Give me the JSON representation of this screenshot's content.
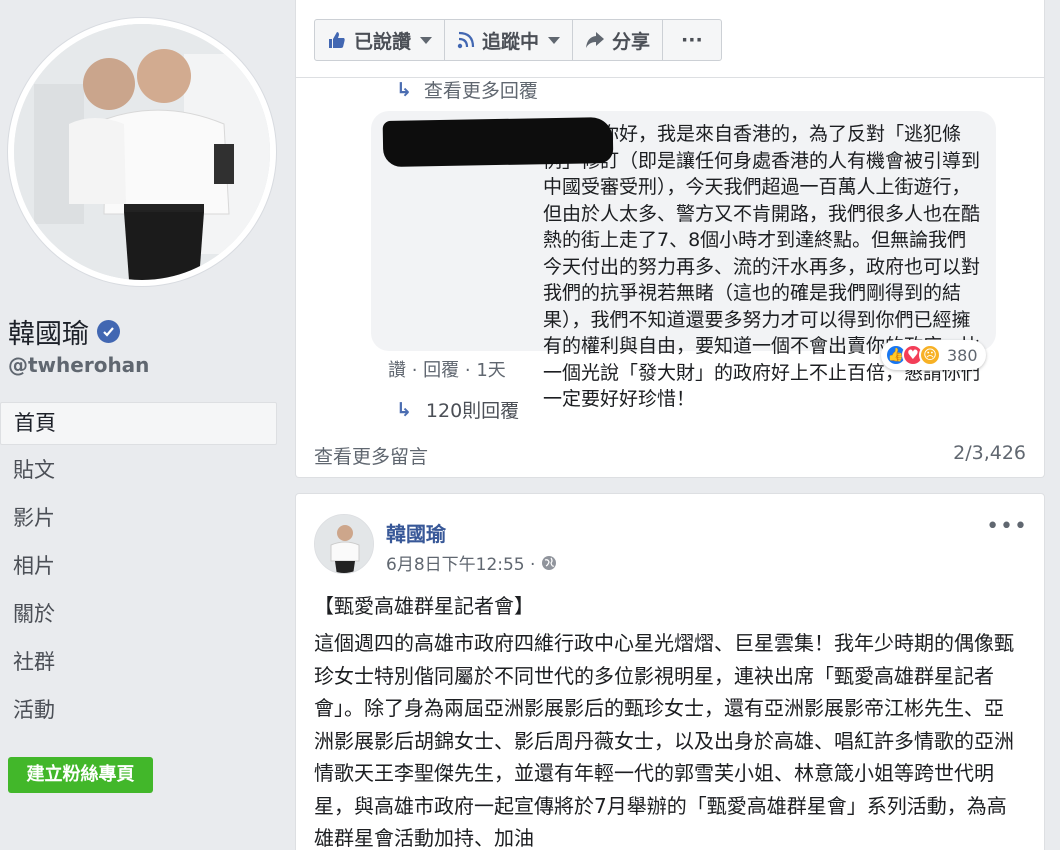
{
  "profile": {
    "name": "韓國瑜",
    "handle": "@twherohan"
  },
  "nav": {
    "items": [
      "首頁",
      "貼文",
      "影片",
      "相片",
      "關於",
      "社群",
      "活動"
    ],
    "create_button": "建立粉絲專頁"
  },
  "action_bar": {
    "liked_label": "已說讚",
    "following_label": "追蹤中",
    "share_label": "分享",
    "more_label": "···"
  },
  "comments": {
    "more_replies_top": "查看更多回覆",
    "comment_text": "台灣人你好，我是來自香港的，為了反對「逃犯條例」修訂（即是讓任何身處香港的人有機會被引導到中國受審受刑），今天我們超過一百萬人上街遊行，但由於人太多、警方又不肯開路，我們很多人也在酷熱的街上走了7、8個小時才到達終點。但無論我們今天付出的努力再多、流的汗水再多，政府也可以對我們的抗爭視若無睹（這也的確是我們剛得到的結果），我們不知道還要多努力才可以得到你們已經擁有的權利與自由，要知道一個不會出賣你的政府，比一個光說「發大財」的政府好上不止百倍，懇請你們一定要好好珍惜！",
    "reaction_count": "380",
    "actions": "讚 · 回覆 · 1天",
    "replies_link": "120則回覆",
    "view_more": "查看更多留言",
    "count": "2/3,426"
  },
  "post": {
    "author": "韓國瑜",
    "timestamp": "6月8日下午12:55 ·",
    "title": "【甄愛高雄群星記者會】",
    "body": "這個週四的高雄市政府四維行政中心星光熠熠、巨星雲集！我年少時期的偶像甄珍女士特別偕同屬於不同世代的多位影視明星，連袂出席「甄愛高雄群星記者會」。除了身為兩屆亞洲影展影后的甄珍女士，還有亞洲影展影帝江彬先生、亞洲影展影后胡錦女士、影后周丹薇女士，以及出身於高雄、唱紅許多情歌的亞洲情歌天王李聖傑先生，並還有年輕一代的郭雪芙小姐、林意箴小姐等跨世代明星，與高雄市政府一起宣傳將於7月舉辦的「甄愛高雄群星會」系列活動，為高雄群星會活動加持、加油",
    "more_label": "•••"
  },
  "colors": {
    "background": "#e9ebee",
    "link_blue": "#385898",
    "verified_blue": "#4267b2",
    "create_green": "#42b72a"
  }
}
